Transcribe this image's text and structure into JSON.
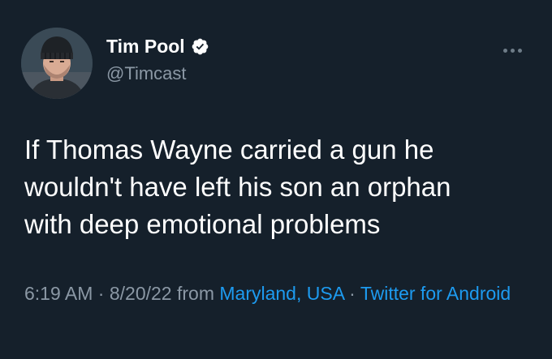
{
  "user": {
    "display_name": "Tim Pool",
    "handle": "@Timcast",
    "verified": true,
    "avatar_icon": "profile-photo"
  },
  "menu": {
    "icon": "more-options-icon"
  },
  "tweet": {
    "text": "If Thomas Wayne carried a gun he\nwouldn't have left his son an orphan\nwith deep emotional problems"
  },
  "meta": {
    "time": "6:19 AM",
    "sep1": " · ",
    "date": "8/20/22",
    "from_word": " from ",
    "location": "Maryland, USA",
    "sep2": " · ",
    "source": "Twitter for Android"
  },
  "colors": {
    "background": "#15202b",
    "text": "#ffffff",
    "muted": "#8b98a5",
    "link": "#1d9bf0"
  }
}
